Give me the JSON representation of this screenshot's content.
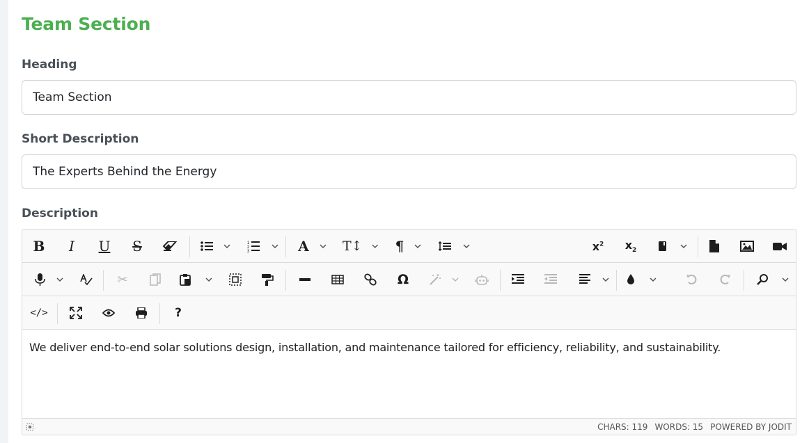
{
  "section": {
    "title": "Team Section"
  },
  "heading": {
    "label": "Heading",
    "value": "Team Section"
  },
  "short_description": {
    "label": "Short Description",
    "value": "The Experts Behind the Energy"
  },
  "description": {
    "label": "Description",
    "content": "We deliver end-to-end solar solutions design, installation, and maintenance tailored for efficiency, reliability, and sustainability.",
    "status": {
      "chars": "CHARS: 119",
      "words": "WORDS: 15",
      "powered": "POWERED BY JODIT"
    }
  },
  "toolbar_icons": [
    "bold-icon",
    "italic-icon",
    "underline-icon",
    "strikethrough-icon",
    "eraser-icon",
    "unordered-list-icon",
    "ordered-list-icon",
    "font-icon",
    "font-size-icon",
    "paragraph-icon",
    "line-height-icon",
    "superscript-icon",
    "subscript-icon",
    "classname-icon",
    "file-icon",
    "image-icon",
    "video-icon",
    "microphone-icon",
    "spellcheck-icon",
    "cut-icon",
    "copy-icon",
    "paste-icon",
    "select-all-icon",
    "copy-format-icon",
    "horizontal-rule-icon",
    "table-icon",
    "link-icon",
    "symbols-icon",
    "ai-commands-icon",
    "ai-assistant-icon",
    "indent-icon",
    "outdent-icon",
    "align-icon",
    "brush-icon",
    "undo-icon",
    "redo-icon",
    "find-icon",
    "source-icon",
    "fullsize-icon",
    "preview-icon",
    "print-icon",
    "about-icon"
  ],
  "colors": {
    "accent": "#4caf50",
    "label": "#495057",
    "border": "#ced4da"
  }
}
